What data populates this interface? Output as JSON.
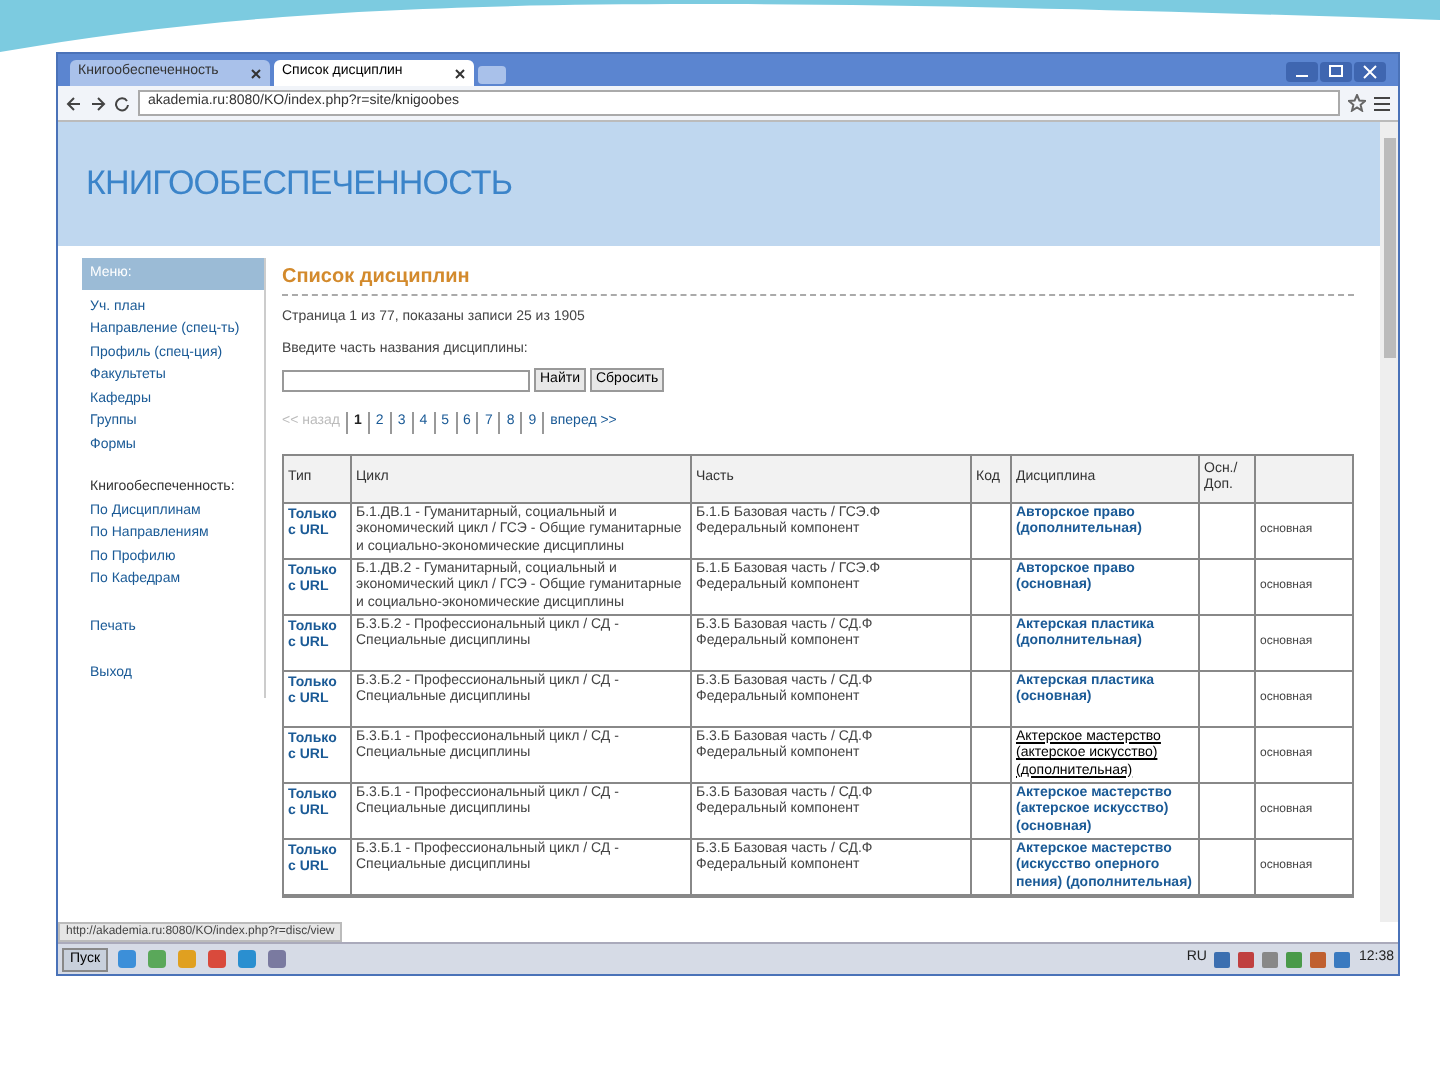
{
  "browser": {
    "tabs": [
      {
        "label": "Книгообеспеченность",
        "selected": false
      },
      {
        "label": "Список дисциплин",
        "selected": true
      }
    ],
    "address": "akademia.ru:8080/KO/index.php?r=site/knigoobes"
  },
  "header": {
    "title": "КНИГООБЕСПЕЧЕННОСТЬ"
  },
  "sidebar": {
    "menu_title": "Меню:",
    "items": [
      "Уч. план",
      "Направление (спец-ть)",
      "Профиль (спец-ция)",
      "Факультеты",
      "Кафедры",
      "Группы",
      "Формы"
    ],
    "section_title": "Книгообеспеченность:",
    "section_items": [
      "По Дисциплинам",
      "По Направлениям",
      "По Профилю",
      "По Кафедрам"
    ],
    "bottom_items": [
      "Печать",
      "Выход"
    ]
  },
  "content": {
    "title": "Список дисциплин",
    "summary": "Страница 1 из 77, показаны записи 25 из 1905",
    "search_label": "Введите часть названия дисциплины:",
    "buttons": [
      "Найти",
      "Сбросить"
    ],
    "pagination": [
      {
        "label": "<< назад",
        "selected": false,
        "disabled": true
      },
      {
        "label": "1",
        "selected": true,
        "disabled": false
      },
      {
        "label": "2",
        "selected": false,
        "disabled": false
      },
      {
        "label": "3",
        "selected": false,
        "disabled": false
      },
      {
        "label": "4",
        "selected": false,
        "disabled": false
      },
      {
        "label": "5",
        "selected": false,
        "disabled": false
      },
      {
        "label": "6",
        "selected": false,
        "disabled": false
      },
      {
        "label": "7",
        "selected": false,
        "disabled": false
      },
      {
        "label": "8",
        "selected": false,
        "disabled": false
      },
      {
        "label": "9",
        "selected": false,
        "disabled": false
      },
      {
        "label": "вперед >>",
        "selected": false,
        "disabled": false
      }
    ]
  },
  "table": {
    "columns": [
      "Тип",
      "Цикл",
      "Часть",
      "Код",
      "Дисциплина",
      "Осн./Доп."
    ],
    "rows": [
      {
        "type": "Только с URL",
        "cycle": "Б.1.ДВ.1 - Гуманитарный, социальный и экономический цикл / ГСЭ - Общие гуманитарные и социально-экономические дисциплины",
        "part": "Б.1.Б Базовая часть / ГСЭ.Ф Федеральный компонент",
        "discipline": "Авторское право (дополнительная)",
        "hovered": false,
        "column_7": "основная"
      },
      {
        "type": "Только с URL",
        "cycle": "Б.1.ДВ.2 - Гуманитарный, социальный и экономический цикл / ГСЭ - Общие гуманитарные и социально-экономические дисциплины",
        "part": "Б.1.Б Базовая часть / ГСЭ.Ф Федеральный компонент",
        "discipline": "Авторское право (основная)",
        "hovered": false,
        "column_7": "основная"
      },
      {
        "type": "Только с URL",
        "cycle": "Б.3.Б.2 - Профессиональный цикл / СД - Специальные дисциплины",
        "part": "Б.3.Б Базовая часть / СД.Ф Федеральный компонент",
        "discipline": "Актерская пластика (дополнительная)",
        "hovered": false,
        "column_7": "основная"
      },
      {
        "type": "Только с URL",
        "cycle": "Б.3.Б.2 - Профессиональный цикл / СД - Специальные дисциплины",
        "part": "Б.3.Б Базовая часть / СД.Ф Федеральный компонент",
        "discipline": "Актерская пластика (основная)",
        "hovered": false,
        "column_7": "основная"
      },
      {
        "type": "Только с URL",
        "cycle": "Б.3.Б.1 - Профессиональный цикл / СД - Специальные дисциплины",
        "part": "Б.3.Б Базовая часть / СД.Ф Федеральный компонент",
        "discipline": "Актерское мастерство (актерское искусство) (дополнительная)",
        "hovered": true,
        "column_7": "основная"
      },
      {
        "type": "Только с URL",
        "cycle": "Б.3.Б.1 - Профессиональный цикл / СД - Специальные дисциплины",
        "part": "Б.3.Б Базовая часть / СД.Ф Федеральный компонент",
        "discipline": "Актерское мастерство (актерское искусство) (основная)",
        "hovered": false,
        "column_7": "основная"
      },
      {
        "type": "Только с URL",
        "cycle": "Б.3.Б.1 - Профессиональный цикл / СД - Специальные дисциплины",
        "part": "Б.3.Б Базовая часть / СД.Ф Федеральный компонент",
        "discipline": "Актерское мастерство (искусство оперного пения) (дополнительная)",
        "hovered": false,
        "column_7": "основная"
      }
    ]
  },
  "status_bar": {
    "url": "http://akademia.ru:8080/KO/index.php?r=disc/view"
  },
  "taskbar": {
    "start": "Пуск",
    "language": "RU",
    "clock": "12:38"
  }
}
